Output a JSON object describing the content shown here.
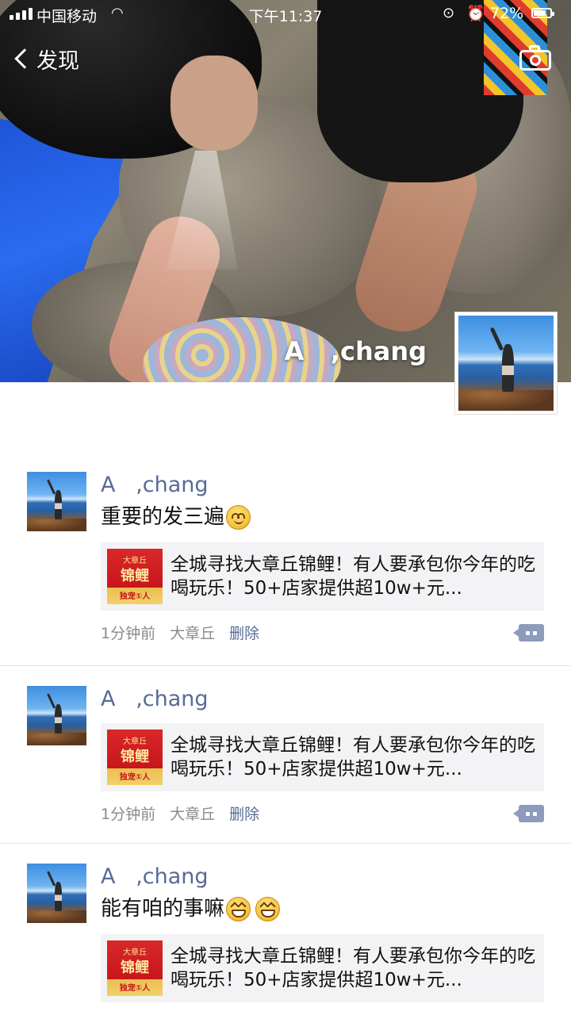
{
  "status_bar": {
    "carrier": "中国移动",
    "time": "下午11:37",
    "battery": "72%"
  },
  "nav": {
    "back_label": "发现"
  },
  "cover": {
    "username": "A   ,chang"
  },
  "posts": [
    {
      "name": "A   ,chang",
      "text": "重要的发三遍",
      "emojis": [
        "smile"
      ],
      "link": {
        "title": "全城寻找大章丘锦鲤！有人要承包你今年的吃喝玩乐！50+店家提供超10w+元...",
        "thumb_top": "大章丘",
        "thumb_main": "锦鲤",
        "thumb_bottom": "独宠①人"
      },
      "time": "1分钟前",
      "location": "大章丘",
      "delete": "删除"
    },
    {
      "name": "A   ,chang",
      "text": "",
      "emojis": [],
      "link": {
        "title": "全城寻找大章丘锦鲤！有人要承包你今年的吃喝玩乐！50+店家提供超10w+元...",
        "thumb_top": "大章丘",
        "thumb_main": "锦鲤",
        "thumb_bottom": "独宠①人"
      },
      "time": "1分钟前",
      "location": "大章丘",
      "delete": "删除"
    },
    {
      "name": "A   ,chang",
      "text": "能有咱的事嘛",
      "emojis": [
        "grin",
        "grin"
      ],
      "link": {
        "title": "全城寻找大章丘锦鲤！有人要承包你今年的吃喝玩乐！50+店家提供超10w+元...",
        "thumb_top": "大章丘",
        "thumb_main": "锦鲤",
        "thumb_bottom": "独宠①人"
      },
      "time": "",
      "location": "",
      "delete": ""
    }
  ]
}
